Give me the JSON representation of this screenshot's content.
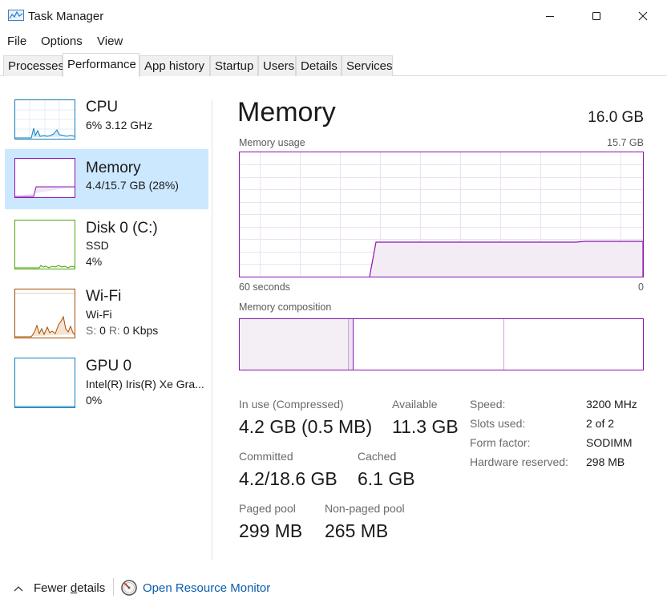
{
  "window": {
    "title": "Task Manager",
    "minimize_icon": "minimize-icon",
    "maximize_icon": "maximize-icon",
    "close_icon": "close-icon"
  },
  "menu": [
    "File",
    "Options",
    "View"
  ],
  "tabs": [
    "Processes",
    "Performance",
    "App history",
    "Startup",
    "Users",
    "Details",
    "Services"
  ],
  "active_tab": "Performance",
  "sidebar": {
    "items": [
      {
        "name": "CPU",
        "sub1": "6%  3.12 GHz",
        "color": "#117dbb"
      },
      {
        "name": "Memory",
        "sub1": "4.4/15.7 GB (28%)",
        "color": "#8b12ae",
        "selected": true
      },
      {
        "name": "Disk 0 (C:)",
        "sub1": "SSD",
        "sub2": "4%",
        "color": "#4da60c"
      },
      {
        "name": "Wi-Fi",
        "sub1": "Wi-Fi",
        "sub2_s_label": "S:",
        "sub2_s_value": "0",
        "sub2_r_label": "R:",
        "sub2_r_value": "0 Kbps",
        "color": "#a74f01"
      },
      {
        "name": "GPU 0",
        "sub1": "Intel(R) Iris(R) Xe Gra...",
        "sub2": "0%",
        "color": "#117dbb"
      }
    ]
  },
  "main": {
    "title": "Memory",
    "total": "16.0 GB",
    "usage_label": "Memory usage",
    "usage_max": "15.7 GB",
    "axis_left": "60 seconds",
    "axis_right": "0",
    "composition_label": "Memory composition",
    "usage_percent": 28,
    "stats": {
      "in_use_label": "In use (Compressed)",
      "in_use_value": "4.2 GB (0.5 MB)",
      "available_label": "Available",
      "available_value": "11.3 GB",
      "committed_label": "Committed",
      "committed_value": "4.2/18.6 GB",
      "cached_label": "Cached",
      "cached_value": "6.1 GB",
      "paged_label": "Paged pool",
      "paged_value": "299 MB",
      "nonpaged_label": "Non-paged pool",
      "nonpaged_value": "265 MB"
    },
    "details": [
      {
        "label": "Speed:",
        "value": "3200 MHz"
      },
      {
        "label": "Slots used:",
        "value": "2 of 2"
      },
      {
        "label": "Form factor:",
        "value": "SODIMM"
      },
      {
        "label": "Hardware reserved:",
        "value": "298 MB"
      }
    ]
  },
  "footer": {
    "fewer_prefix": "Fewer ",
    "fewer_underlined": "d",
    "fewer_suffix": "etails",
    "resource_monitor": "Open Resource Monitor"
  },
  "colors": {
    "accent_memory": "#8b12ae",
    "selection": "#cce8ff",
    "link": "#0b5cad"
  }
}
